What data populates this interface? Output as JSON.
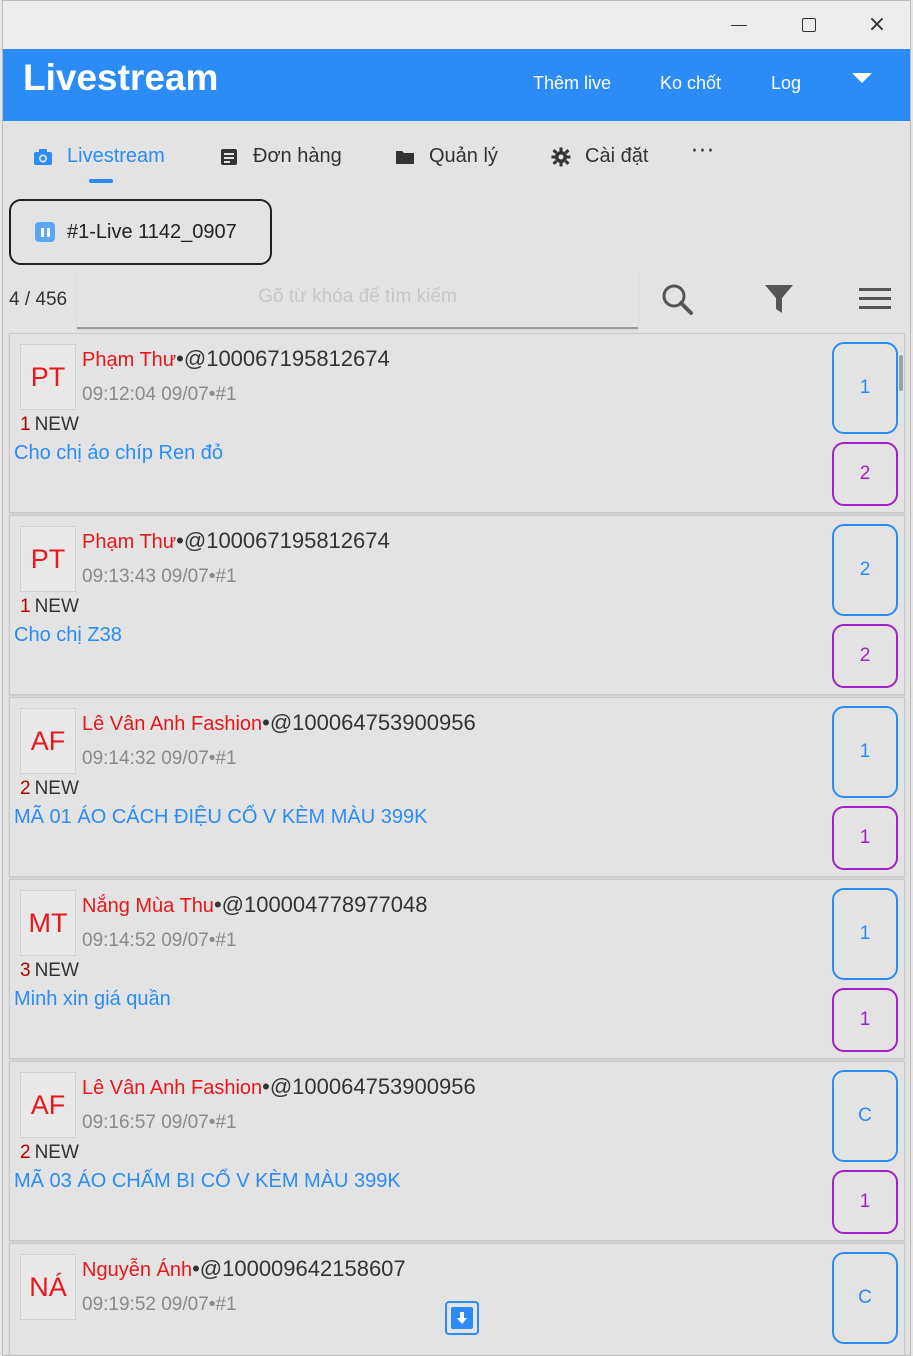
{
  "window": {
    "controls": {
      "minimize": "minimize",
      "maximize": "maximize",
      "close": "×"
    }
  },
  "appbar": {
    "title": "Livestream",
    "actions": [
      "Thêm live",
      "Ko chốt",
      "Log"
    ],
    "menu_icon": "caret-down-icon"
  },
  "tabs": [
    {
      "label": "Livestream",
      "icon": "camera-icon",
      "active": true
    },
    {
      "label": "Đơn hàng",
      "icon": "document-icon",
      "active": false
    },
    {
      "label": "Quản lý",
      "icon": "folder-icon",
      "active": false
    },
    {
      "label": "Cài đặt",
      "icon": "gear-icon",
      "active": false
    }
  ],
  "more_label": "···",
  "live_chip": {
    "label": "#1-Live 1142_0907",
    "icon": "pause-icon"
  },
  "toolbar": {
    "count": "4 / 456",
    "search_placeholder": "Gõ từ khóa để tìm kiếm"
  },
  "comments": [
    {
      "avatar": "PT",
      "name": "Phạm Thư",
      "uid": "•@100067195812674",
      "time": "09:12:04 09/07•#1",
      "new_count": "1",
      "new_label": "NEW",
      "text": "Cho chị áo chíp Ren đỏ",
      "badge_top": "1",
      "badge_bottom": "2"
    },
    {
      "avatar": "PT",
      "name": "Phạm Thư",
      "uid": "•@100067195812674",
      "time": "09:13:43 09/07•#1",
      "new_count": "1",
      "new_label": "NEW",
      "text": "Cho chị Z38",
      "badge_top": "2",
      "badge_bottom": "2"
    },
    {
      "avatar": "AF",
      "name": "Lê Vân Anh Fashion",
      "uid": "•@100064753900956",
      "time": "09:14:32 09/07•#1",
      "new_count": "2",
      "new_label": "NEW",
      "text": "MÃ  01 ÁO CÁCH ĐIỆU CỔ V KÈM MÀU 399K",
      "badge_top": "1",
      "badge_bottom": "1"
    },
    {
      "avatar": "MT",
      "name": "Nắng Mùa Thu",
      "uid": "•@100004778977048",
      "time": "09:14:52 09/07•#1",
      "new_count": "3",
      "new_label": "NEW",
      "text": "Minh xin giá quần",
      "badge_top": "1",
      "badge_bottom": "1"
    },
    {
      "avatar": "AF",
      "name": "Lê Vân Anh Fashion",
      "uid": "•@100064753900956",
      "time": "09:16:57 09/07•#1",
      "new_count": "2",
      "new_label": "NEW",
      "text": "MÃ  03 ÁO CHẤM BI CỔ V KÈM MÀU 399K",
      "badge_top": "C",
      "badge_bottom": "1"
    },
    {
      "avatar": "NÁ",
      "name": "Nguyễn Ánh",
      "uid": "•@100009642158607",
      "time": "09:19:52 09/07•#1",
      "new_count": "",
      "new_label": "",
      "text": "",
      "badge_top": "C",
      "badge_bottom": ""
    }
  ],
  "colors": {
    "accent": "#2b8cf7",
    "name_red": "#e8171b",
    "badge_purple": "#a020c9",
    "count_red": "#b00000"
  }
}
